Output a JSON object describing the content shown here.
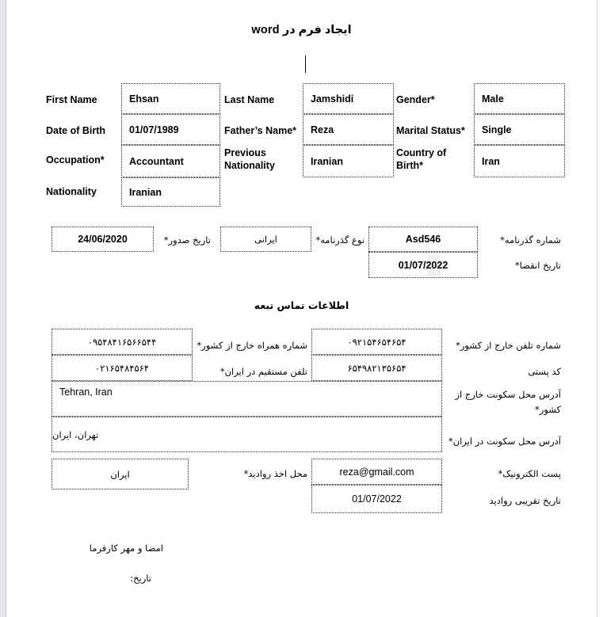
{
  "document": {
    "title": "ایجاد فرم در  word",
    "section_contact_heading": "اطلاعات تماس تبعه"
  },
  "personal_table": {
    "rows": [
      {
        "label1": "First Name",
        "value1": "Ehsan",
        "label2": "Last Name",
        "value2": "Jamshidi",
        "label3": "Gender*",
        "value3": "Male"
      },
      {
        "label1": "Date of Birth",
        "value1": "01/07/1989",
        "label2": "Father’s Name*",
        "value2": "Reza",
        "label3": "Marital Status*",
        "value3": "Single"
      },
      {
        "label1": "Occupation*",
        "value1": "Accountant",
        "label2": "Previous Nationality",
        "value2": "Iranian",
        "label3": "Country of Birth*",
        "value3": "Iran"
      },
      {
        "label1": "Nationality",
        "value1": "Iranian",
        "label2": "",
        "value2": "",
        "label3": "",
        "value3": ""
      }
    ]
  },
  "passport_section": {
    "passport_number_label": "شماره گذرنامه*",
    "passport_number_value": "Asd546",
    "expiry_label": "تاریخ انقضا*",
    "expiry_value": "01/07/2022",
    "type_label": "نوع گذرنامه*",
    "type_value": "ایرانی",
    "issue_label": "تاریخ صدور*",
    "issue_value": "24/06/2020"
  },
  "contact_section": {
    "phone_abroad_label": "شماره تلفن خارج از کشور*",
    "phone_abroad_value": "۰۹۲۱۵۴۶۵۴۶۵۴",
    "mobile_abroad_label": "شماره همراه خارج از کشور*",
    "mobile_abroad_value": "۰۹۵۴۸۴۱۶۵۶۶۵۴۴",
    "postal_code_label": "کد پستی",
    "postal_code_value": "۶۵۴۹۸۲۱۳۵۶۵۴",
    "phone_iran_label": "تلفن مستقیم در ایران*",
    "phone_iran_value": "۰۲۱۶۵۴۸۴۵۶۴",
    "address_abroad_label": "آدرس محل سکونت خارج از کشور*",
    "address_abroad_value": "Tehran, Iran",
    "address_iran_label": "آدرس محل سکونت در ایران*",
    "address_iran_value": "تهران، ایران",
    "email_label": "پست الکترونیک*",
    "email_value": "reza@gmail.com",
    "visa_date_label": "تاریخ تقریبی روادید",
    "visa_date_value": "01/07/2022",
    "visa_place_label": "محل اخذ روادید*",
    "visa_place_value": "ایران"
  },
  "footer": {
    "signature": "امضا و مهر کارفرما",
    "date_label": "تاریخ:"
  }
}
